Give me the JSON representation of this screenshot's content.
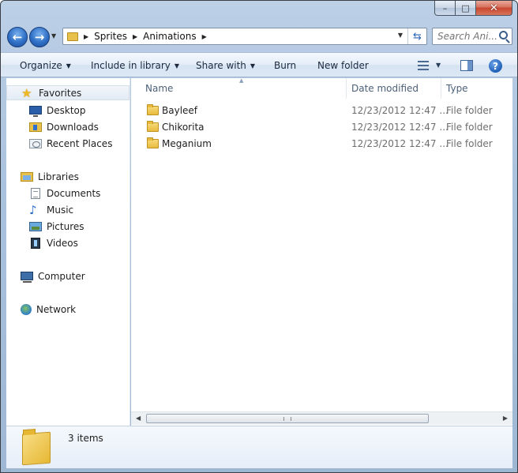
{
  "window": {
    "caption": {
      "minimize": "–",
      "maximize": "□",
      "close": "✕"
    }
  },
  "address_bar": {
    "breadcrumbs": [
      "Sprites",
      "Animations"
    ]
  },
  "search": {
    "placeholder": "Search Ani..."
  },
  "toolbar": {
    "organize": "Organize",
    "include_in_library": "Include in library",
    "share_with": "Share with",
    "burn": "Burn",
    "new_folder": "New folder"
  },
  "navigation": {
    "favorites": {
      "label": "Favorites",
      "items": [
        "Desktop",
        "Downloads",
        "Recent Places"
      ]
    },
    "libraries": {
      "label": "Libraries",
      "items": [
        "Documents",
        "Music",
        "Pictures",
        "Videos"
      ]
    },
    "computer": "Computer",
    "network": "Network"
  },
  "columns": {
    "name": "Name",
    "date_modified": "Date modified",
    "type": "Type"
  },
  "files": [
    {
      "name": "Bayleef",
      "date_modified": "12/23/2012 12:47 ...",
      "type": "File folder"
    },
    {
      "name": "Chikorita",
      "date_modified": "12/23/2012 12:47 ...",
      "type": "File folder"
    },
    {
      "name": "Meganium",
      "date_modified": "12/23/2012 12:47 ...",
      "type": "File folder"
    }
  ],
  "details_pane": {
    "item_count": "3 items"
  },
  "colors": {
    "frame": "#a9c2dd",
    "selection": "#e3ebf5",
    "folder": "#e8bb3d",
    "link_blue": "#2f6fc6"
  },
  "icons": [
    "back-arrow-icon",
    "forward-arrow-icon",
    "folder-icon",
    "refresh-icon",
    "search-icon",
    "star-icon",
    "desktop-icon",
    "downloads-icon",
    "recent-places-icon",
    "libraries-icon",
    "documents-icon",
    "music-icon",
    "pictures-icon",
    "videos-icon",
    "computer-icon",
    "network-icon",
    "view-options-icon",
    "preview-pane-icon",
    "help-icon"
  ]
}
